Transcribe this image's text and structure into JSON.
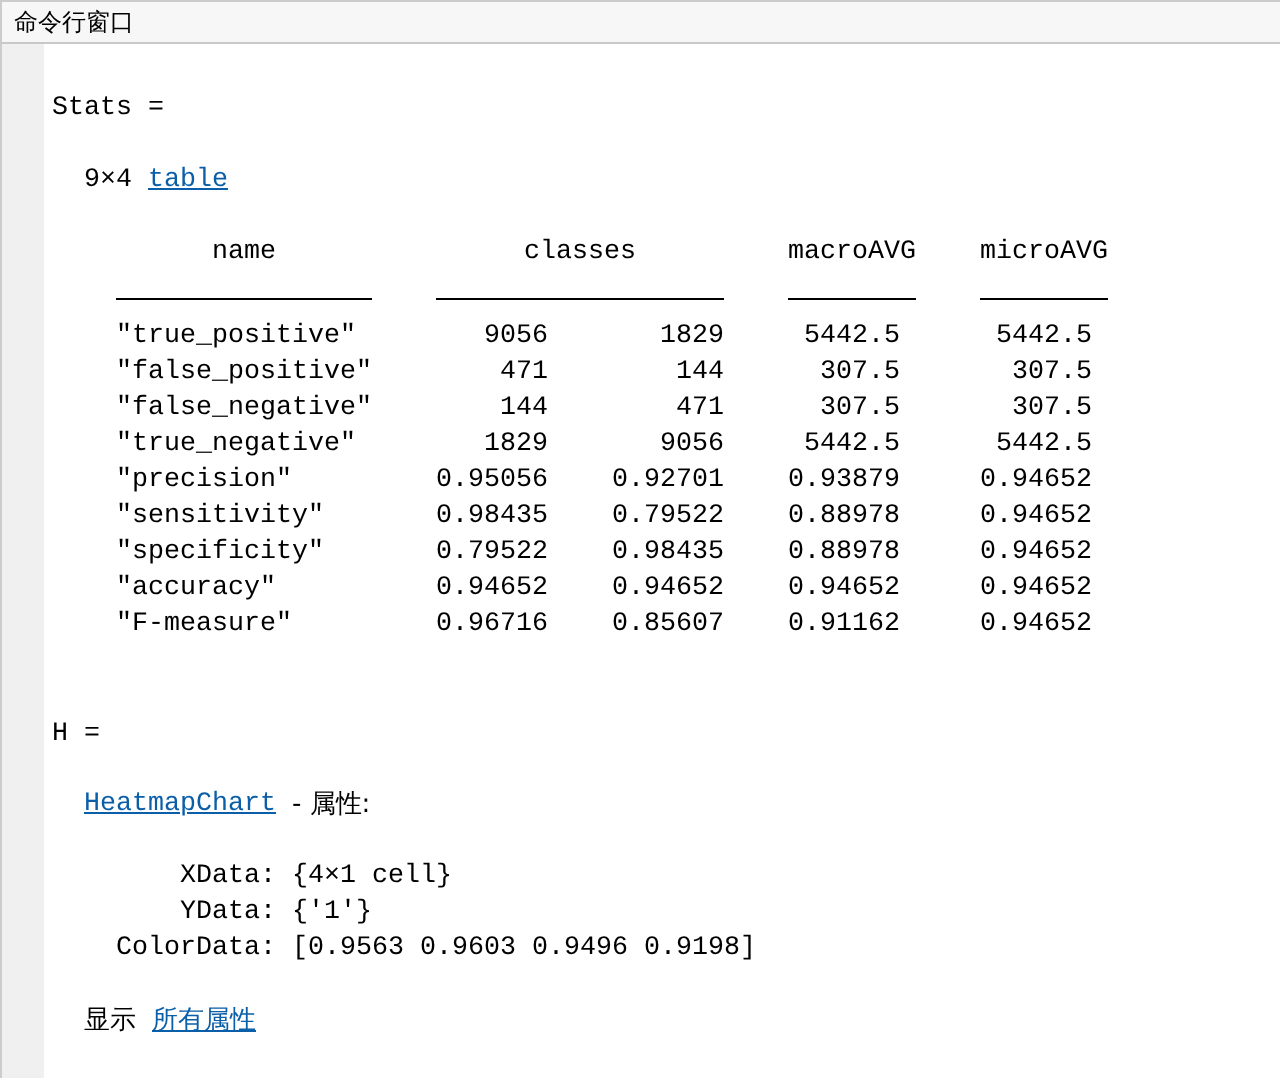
{
  "window": {
    "title": "命令行窗口"
  },
  "stats": {
    "header": "Stats =",
    "size": "9×4",
    "type_link": "table",
    "columns": [
      "name",
      "classes",
      "macroAVG",
      "microAVG"
    ],
    "rows": [
      {
        "name": "\"true_positive\"",
        "classes": [
          "9056",
          "1829"
        ],
        "macroAVG": "5442.5",
        "microAVG": "5442.5"
      },
      {
        "name": "\"false_positive\"",
        "classes": [
          "471",
          "144"
        ],
        "macroAVG": "307.5",
        "microAVG": "307.5"
      },
      {
        "name": "\"false_negative\"",
        "classes": [
          "144",
          "471"
        ],
        "macroAVG": "307.5",
        "microAVG": "307.5"
      },
      {
        "name": "\"true_negative\"",
        "classes": [
          "1829",
          "9056"
        ],
        "macroAVG": "5442.5",
        "microAVG": "5442.5"
      },
      {
        "name": "\"precision\"",
        "classes": [
          "0.95056",
          "0.92701"
        ],
        "macroAVG": "0.93879",
        "microAVG": "0.94652"
      },
      {
        "name": "\"sensitivity\"",
        "classes": [
          "0.98435",
          "0.79522"
        ],
        "macroAVG": "0.88978",
        "microAVG": "0.94652"
      },
      {
        "name": "\"specificity\"",
        "classes": [
          "0.79522",
          "0.98435"
        ],
        "macroAVG": "0.88978",
        "microAVG": "0.94652"
      },
      {
        "name": "\"accuracy\"",
        "classes": [
          "0.94652",
          "0.94652"
        ],
        "macroAVG": "0.94652",
        "microAVG": "0.94652"
      },
      {
        "name": "\"F-measure\"",
        "classes": [
          "0.96716",
          "0.85607"
        ],
        "macroAVG": "0.91162",
        "microAVG": "0.94652"
      }
    ]
  },
  "h": {
    "header": "H =",
    "class_link": "HeatmapChart",
    "properties_label": "- 属性:",
    "properties": [
      {
        "name": "XData:",
        "value": "{4×1 cell}"
      },
      {
        "name": "YData:",
        "value": "{'1'}"
      },
      {
        "name": "ColorData:",
        "value": "[0.9563 0.9603 0.9496 0.9198]"
      }
    ],
    "show_label": "显示",
    "all_properties_link": "所有属性"
  }
}
